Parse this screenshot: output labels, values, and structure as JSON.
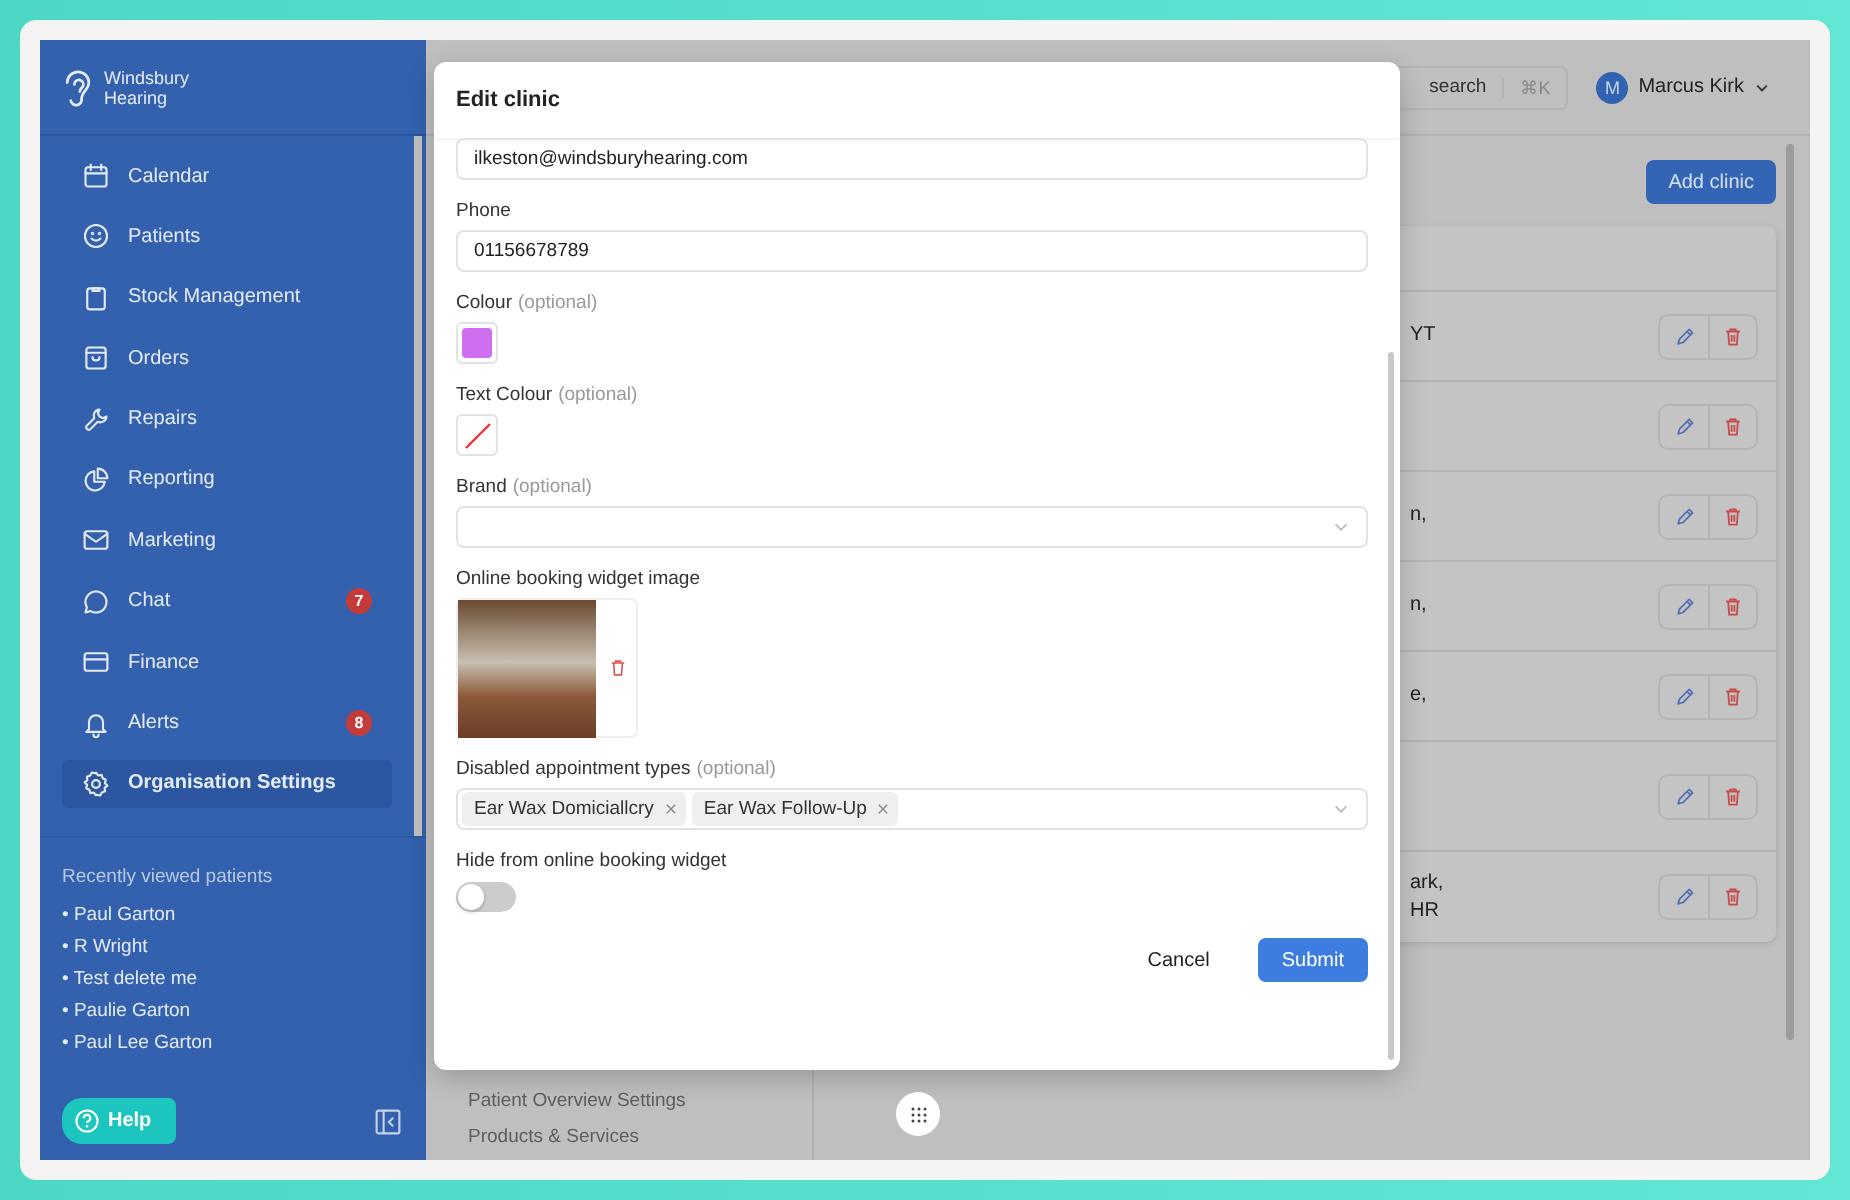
{
  "sidebar": {
    "logo": "Windsbury Hearing",
    "items": [
      {
        "label": "Calendar",
        "selected": false
      },
      {
        "label": "Patients",
        "selected": false
      },
      {
        "label": "Stock Management",
        "selected": false
      },
      {
        "label": "Orders",
        "selected": false
      },
      {
        "label": "Repairs",
        "selected": false
      },
      {
        "label": "Reporting",
        "selected": false
      },
      {
        "label": "Marketing",
        "selected": false
      },
      {
        "label": "Chat",
        "selected": false,
        "badge": "7"
      },
      {
        "label": "Finance",
        "selected": false
      },
      {
        "label": "Alerts",
        "selected": false,
        "badge": "8"
      },
      {
        "label": "Organisation Settings",
        "selected": true
      }
    ],
    "recent_title": "Recently viewed patients",
    "recent": [
      "• Paul Garton",
      "• R Wright",
      "• Test delete me",
      "• Paulie Garton",
      "• Paul Lee Garton"
    ],
    "help": "Help"
  },
  "topbar": {
    "search": "search",
    "shortcut": "⌘K",
    "avatar": "M",
    "user": "Marcus Kirk"
  },
  "settings_nav": [
    "Patient Overview Settings",
    "Products & Services"
  ],
  "page": {
    "add_button": "Add clinic",
    "rows": [
      {
        "lines": [
          "YT"
        ]
      },
      {},
      {
        "lines": [
          "n,"
        ]
      },
      {
        "lines": [
          "n,"
        ]
      },
      {
        "lines": [
          "e,"
        ]
      },
      {},
      {
        "lines": [
          "ark,",
          "HR"
        ]
      }
    ]
  },
  "modal": {
    "title": "Edit clinic",
    "fields": [
      {
        "kind": "text",
        "value": "ilkeston@windsburyhearing.com"
      },
      {
        "kind": "text",
        "label": "Phone",
        "value": "01156678789"
      },
      {
        "kind": "color",
        "label": "Colour",
        "optional": "(optional)",
        "color": "#cf6ff0"
      },
      {
        "kind": "color",
        "label": "Text Colour",
        "optional": "(optional)"
      },
      {
        "kind": "select",
        "label": "Brand",
        "optional": "(optional)"
      },
      {
        "kind": "image",
        "label": "Online booking widget image"
      },
      {
        "kind": "multiselect",
        "label": "Disabled appointment types",
        "optional": "(optional)",
        "chips": [
          "Ear Wax Domiciallcry",
          "Ear Wax Follow-Up"
        ]
      },
      {
        "kind": "toggle",
        "label": "Hide from online booking widget",
        "on": false
      }
    ],
    "buttons": [
      {
        "label": "Cancel",
        "kind": "secondary"
      },
      {
        "label": "Submit",
        "kind": "primary"
      }
    ]
  }
}
